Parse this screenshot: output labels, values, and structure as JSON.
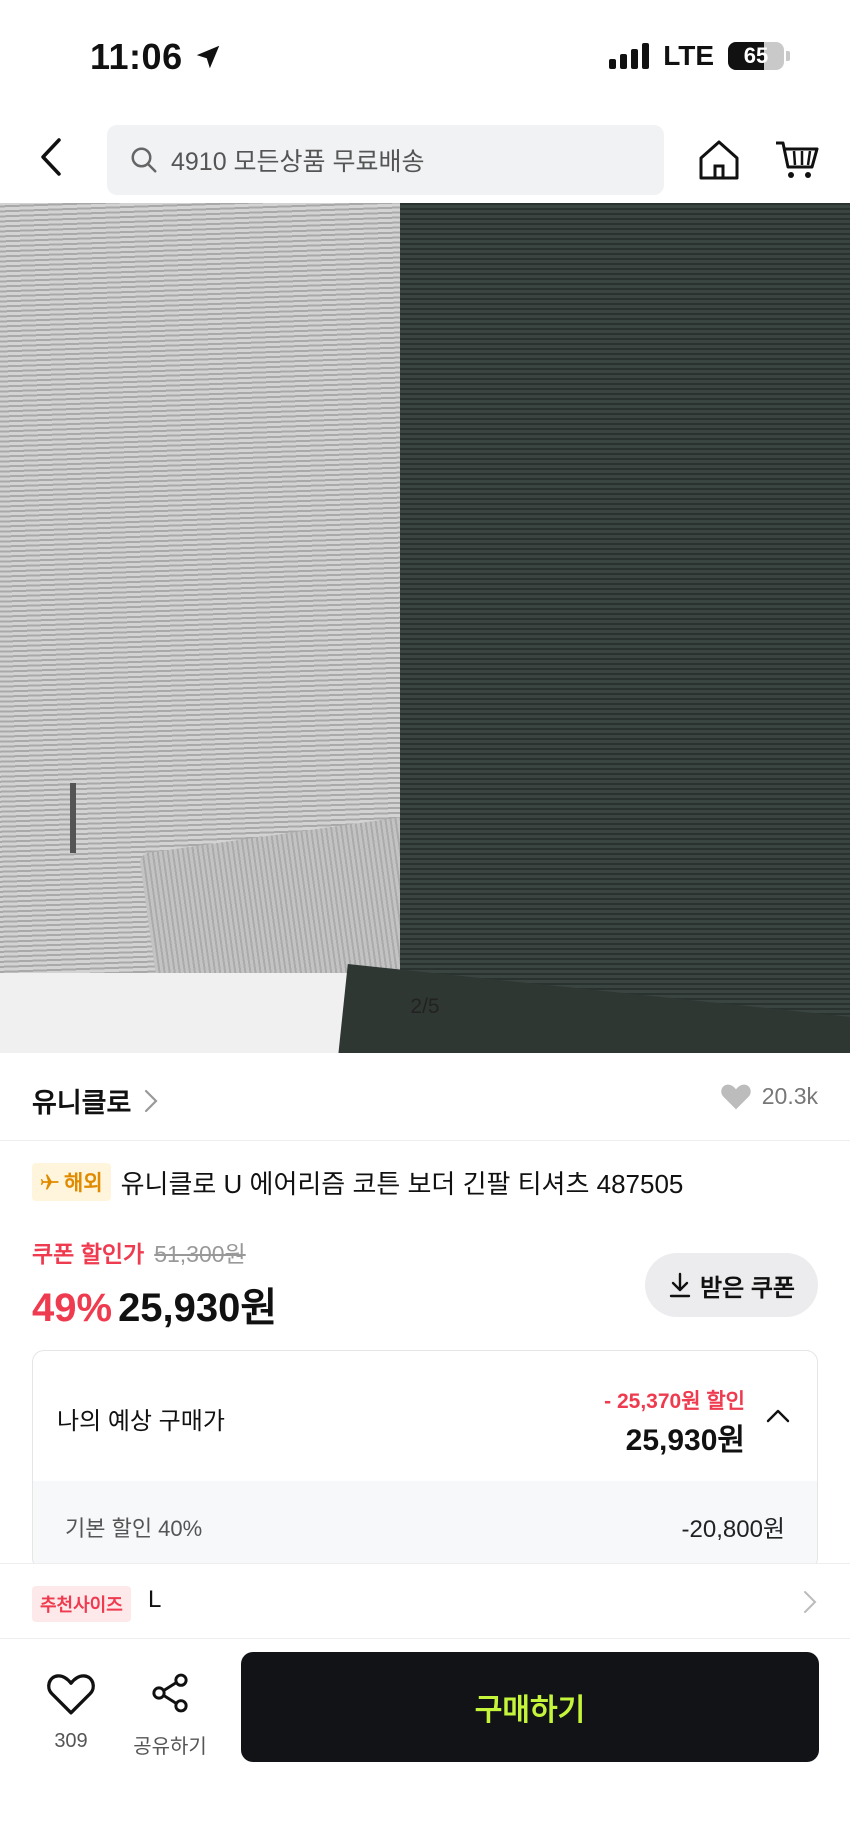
{
  "status_bar": {
    "time": "11:06",
    "network": "LTE",
    "battery": "65",
    "battery_level": 0.65
  },
  "top_nav": {
    "search_text": "4910 모든상품 무료배송"
  },
  "gallery": {
    "page_indicator": "2/5"
  },
  "brand": {
    "name": "유니클로",
    "like_count": "20.3k"
  },
  "product": {
    "badge": "해외",
    "title": "유니클로 U 에어리즘 코튼 보더 긴팔 티셔츠 487505"
  },
  "price": {
    "coupon_label": "쿠폰 할인가",
    "original_price": "51,300원",
    "discount_rate": "49%",
    "sale_price": "25,930원",
    "coupon_button_label": "받은 쿠폰"
  },
  "expected_price": {
    "label": "나의 예상 구매가",
    "discount_text": "- 25,370원 할인",
    "price": "25,930원",
    "detail_label": "기본 할인 40%",
    "detail_value": "-20,800원"
  },
  "size_recommendation": {
    "badge": "추천사이즈",
    "value": "L"
  },
  "bottom_bar": {
    "wish_count": "309",
    "share_label": "공유하기",
    "buy_label": "구매하기"
  },
  "colors": {
    "accent_red": "#ef3b4f",
    "buy_button_bg": "#111317",
    "buy_button_text": "#c5f53a",
    "overseas_badge": "#e08a00"
  },
  "icons": [
    "location-arrow-icon",
    "signal-icon",
    "battery-icon",
    "back-icon",
    "search-icon",
    "home-icon",
    "cart-icon",
    "chevron-right-icon",
    "heart-icon",
    "airplane-icon",
    "download-icon",
    "chevron-up-icon",
    "share-icon"
  ]
}
